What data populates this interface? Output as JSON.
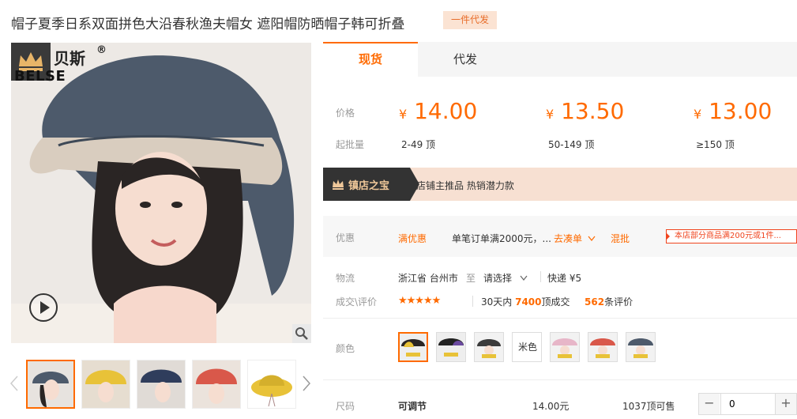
{
  "title": "帽子夏季日系双面拼色大沿春秋渔夫帽女 遮阳帽防晒帽子韩可折叠",
  "title_badge": "一件代发",
  "brand": {
    "name": "贝斯",
    "reg": "®",
    "latin": "BELSE"
  },
  "tabs": [
    {
      "label": "现货"
    },
    {
      "label": "代发"
    }
  ],
  "price_label": "价格",
  "qty_label": "起批量",
  "currency": "¥",
  "tiers": [
    {
      "price": "14.00",
      "range": "2-49 顶"
    },
    {
      "price": "13.50",
      "range": "50-149 顶"
    },
    {
      "price": "13.00",
      "range": "≥150 顶"
    }
  ],
  "treasure": {
    "title": "镇店之宝",
    "text": "店铺主推品   热销潜力款"
  },
  "promo": {
    "label": "优惠",
    "type": "满优惠",
    "desc": "单笔订单满2000元，...",
    "action": "去凑单",
    "mix": "混批",
    "tag": "本店部分商品满200元或1件..."
  },
  "logistics": {
    "label": "物流",
    "from": "浙江省 台州市",
    "to_word": "至",
    "select": "请选择",
    "express": "快递 ¥5"
  },
  "reviews": {
    "label": "成交\\评价",
    "stars": "★★★★★",
    "period": "30天内",
    "sold": "7400",
    "sold_unit": "顶成交",
    "count": "562",
    "count_unit": "条评价"
  },
  "color_label": "颜色",
  "color_text_option": "米色",
  "size": {
    "label": "尺码",
    "value": "可调节",
    "price": "14.00元",
    "stock": "1037顶可售",
    "qty": "0"
  },
  "colors": {
    "accent": "#ff6a00",
    "hat_navy": "#4d5a6b",
    "hat_yellow": "#e8c238",
    "hat_red": "#d9584a"
  },
  "icons": [
    "crown-icon",
    "play-icon",
    "zoom-icon",
    "chevron-left-icon",
    "chevron-right-icon",
    "chevron-down-icon"
  ]
}
